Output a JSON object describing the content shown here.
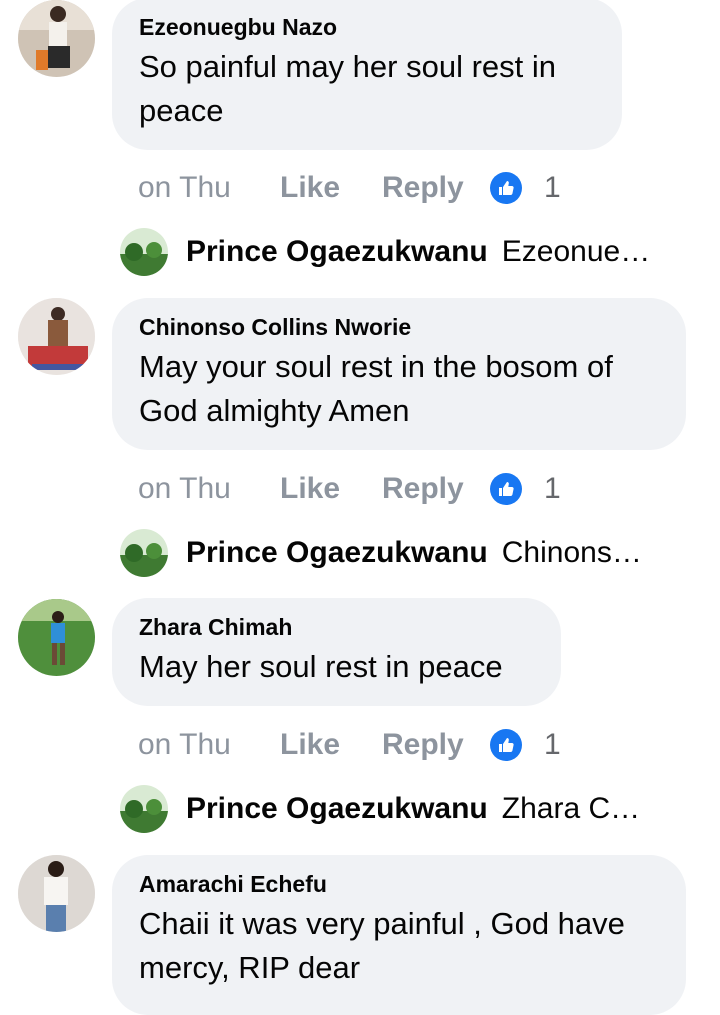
{
  "comments": [
    {
      "author": "Ezeonuegbu Nazo",
      "text_line1": "So painful may her soul rest in",
      "text_line2": "peace",
      "time": "on Thu",
      "like_label": "Like",
      "reply_label": "Reply",
      "like_count": "1",
      "reply": {
        "author": "Prince Ogaezukwanu",
        "preview": "Ezeonue…"
      }
    },
    {
      "author": "Chinonso Collins Nworie",
      "text_line1": "May your soul rest in the bosom of",
      "text_line2": "God almighty Amen",
      "time": "on Thu",
      "like_label": "Like",
      "reply_label": "Reply",
      "like_count": "1",
      "reply": {
        "author": "Prince Ogaezukwanu",
        "preview": "Chinons…"
      }
    },
    {
      "author": "Zhara Chimah",
      "text_line1": "May her soul rest in peace",
      "time": "on Thu",
      "like_label": "Like",
      "reply_label": "Reply",
      "like_count": "1",
      "reply": {
        "author": "Prince Ogaezukwanu",
        "preview": "Zhara C…"
      }
    },
    {
      "author": "Amarachi Echefu",
      "text_line1": "Chaii it was very painful , God have",
      "text_line2": "mercy, RIP dear"
    }
  ],
  "colors": {
    "bubble": "#f0f2f5",
    "meta": "#8d949e",
    "like_badge": "#1877f2"
  },
  "icons": {
    "like_badge": "thumbs-up-icon"
  }
}
